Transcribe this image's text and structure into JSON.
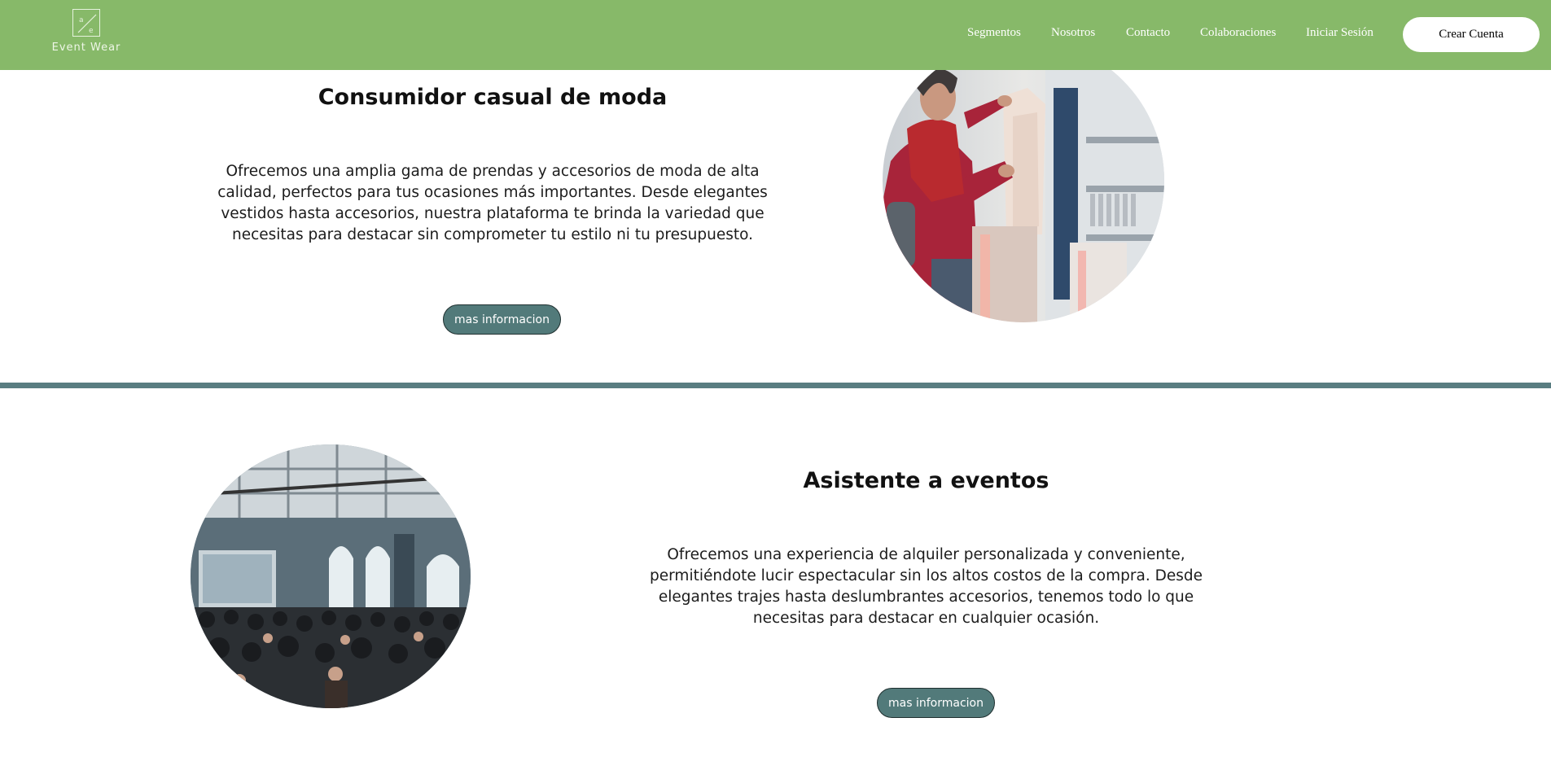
{
  "brand": {
    "name": "Event Wear",
    "nav_color": "#87b969",
    "accent_color": "#527a7a"
  },
  "nav": {
    "links": [
      "Segmentos",
      "Nosotros",
      "Contacto",
      "Colaboraciones",
      "Iniciar Sesión"
    ],
    "cta_label": "Crear Cuenta"
  },
  "sections": [
    {
      "title": "Consumidor casual de moda",
      "body": "Ofrecemos una amplia gama de prendas y accesorios de moda de alta calidad, perfectos para tus ocasiones más importantes. Desde elegantes vestidos hasta accesorios, nuestra plataforma te brinda la variedad que necesitas para destacar sin comprometer tu estilo ni tu presupuesto.",
      "button_label": "mas informacion",
      "image": "woman-shopping-clothes-photo"
    },
    {
      "title": "Asistente a eventos",
      "body": "Ofrecemos una experiencia de alquiler personalizada y conveniente, permitiéndote lucir espectacular sin los altos costos de la compra. Desde elegantes trajes hasta deslumbrantes accesorios, tenemos todo lo que necesitas para destacar en cualquier ocasión.",
      "button_label": "mas informacion",
      "image": "event-crowd-hall-photo"
    }
  ]
}
